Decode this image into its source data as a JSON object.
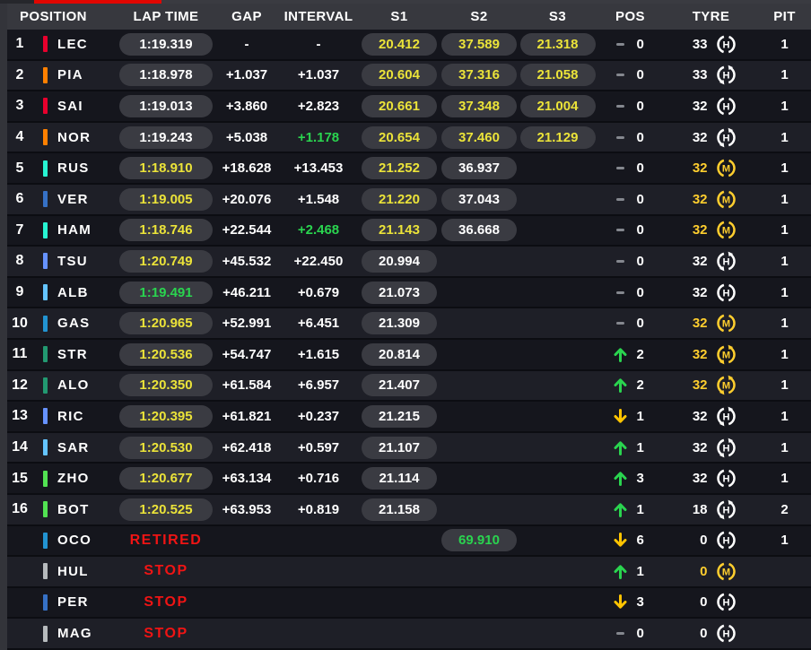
{
  "header": {
    "cols": [
      "POSITION",
      "LAP TIME",
      "GAP",
      "INTERVAL",
      "S1",
      "S2",
      "S3",
      "POS",
      "TYRE",
      "PIT"
    ]
  },
  "colors": {
    "accent_red": "#e10600",
    "sector_yellow": "#ebe339",
    "green": "#2ad44f",
    "tyre_medium_yellow": "#ffce2e",
    "tyre_hard_white": "#ffffff",
    "status_red": "#f01414"
  },
  "rows": [
    {
      "position": "1",
      "team_color": "#E8002D",
      "driver": "LEC",
      "lap_time": "1:19.319",
      "lap_color": "white",
      "lap_pill": true,
      "gap": "-",
      "interval": "-",
      "interval_color": "white",
      "s1": "20.412",
      "s1_color": "yellow",
      "s2": "37.589",
      "s2_color": "yellow",
      "s3": "21.318",
      "s3_color": "yellow",
      "pos_change_dir": "none",
      "pos_change": "0",
      "laps": "33",
      "laps_color": "white",
      "compound": "H",
      "compound_color": "#ffffff",
      "tyre_used": false,
      "pit": "1"
    },
    {
      "position": "2",
      "team_color": "#FF8000",
      "driver": "PIA",
      "lap_time": "1:18.978",
      "lap_color": "white",
      "lap_pill": true,
      "gap": "+1.037",
      "interval": "+1.037",
      "interval_color": "white",
      "s1": "20.604",
      "s1_color": "yellow",
      "s2": "37.316",
      "s2_color": "yellow",
      "s3": "21.058",
      "s3_color": "yellow",
      "pos_change_dir": "none",
      "pos_change": "0",
      "laps": "33",
      "laps_color": "white",
      "compound": "H",
      "compound_color": "#ffffff",
      "tyre_used": true,
      "pit": "1"
    },
    {
      "position": "3",
      "team_color": "#E8002D",
      "driver": "SAI",
      "lap_time": "1:19.013",
      "lap_color": "white",
      "lap_pill": true,
      "gap": "+3.860",
      "interval": "+2.823",
      "interval_color": "white",
      "s1": "20.661",
      "s1_color": "yellow",
      "s2": "37.348",
      "s2_color": "yellow",
      "s3": "21.004",
      "s3_color": "yellow",
      "pos_change_dir": "none",
      "pos_change": "0",
      "laps": "32",
      "laps_color": "white",
      "compound": "H",
      "compound_color": "#ffffff",
      "tyre_used": false,
      "pit": "1"
    },
    {
      "position": "4",
      "team_color": "#FF8000",
      "driver": "NOR",
      "lap_time": "1:19.243",
      "lap_color": "white",
      "lap_pill": true,
      "gap": "+5.038",
      "interval": "+1.178",
      "interval_color": "green",
      "s1": "20.654",
      "s1_color": "yellow",
      "s2": "37.460",
      "s2_color": "yellow",
      "s3": "21.129",
      "s3_color": "yellow",
      "pos_change_dir": "none",
      "pos_change": "0",
      "laps": "32",
      "laps_color": "white",
      "compound": "H",
      "compound_color": "#ffffff",
      "tyre_used": true,
      "pit": "1"
    },
    {
      "position": "5",
      "team_color": "#27F4D2",
      "driver": "RUS",
      "lap_time": "1:18.910",
      "lap_color": "yellow",
      "lap_pill": true,
      "gap": "+18.628",
      "interval": "+13.453",
      "interval_color": "white",
      "s1": "21.252",
      "s1_color": "yellow",
      "s2": "36.937",
      "s2_color": "white",
      "s3": "",
      "s3_color": "white",
      "pos_change_dir": "none",
      "pos_change": "0",
      "laps": "32",
      "laps_color": "tyellow",
      "compound": "M",
      "compound_color": "#ffce2e",
      "tyre_used": false,
      "pit": "1"
    },
    {
      "position": "6",
      "team_color": "#3671C6",
      "driver": "VER",
      "lap_time": "1:19.005",
      "lap_color": "yellow",
      "lap_pill": true,
      "gap": "+20.076",
      "interval": "+1.548",
      "interval_color": "white",
      "s1": "21.220",
      "s1_color": "yellow",
      "s2": "37.043",
      "s2_color": "white",
      "s3": "",
      "s3_color": "white",
      "pos_change_dir": "none",
      "pos_change": "0",
      "laps": "32",
      "laps_color": "tyellow",
      "compound": "M",
      "compound_color": "#ffce2e",
      "tyre_used": false,
      "pit": "1"
    },
    {
      "position": "7",
      "team_color": "#27F4D2",
      "driver": "HAM",
      "lap_time": "1:18.746",
      "lap_color": "yellow",
      "lap_pill": true,
      "gap": "+22.544",
      "interval": "+2.468",
      "interval_color": "green",
      "s1": "21.143",
      "s1_color": "yellow",
      "s2": "36.668",
      "s2_color": "white",
      "s3": "",
      "s3_color": "white",
      "pos_change_dir": "none",
      "pos_change": "0",
      "laps": "32",
      "laps_color": "tyellow",
      "compound": "M",
      "compound_color": "#ffce2e",
      "tyre_used": false,
      "pit": "1"
    },
    {
      "position": "8",
      "team_color": "#6692FF",
      "driver": "TSU",
      "lap_time": "1:20.749",
      "lap_color": "yellow",
      "lap_pill": true,
      "gap": "+45.532",
      "interval": "+22.450",
      "interval_color": "white",
      "s1": "20.994",
      "s1_color": "white",
      "s2": "",
      "s2_color": "white",
      "s3": "",
      "s3_color": "white",
      "pos_change_dir": "none",
      "pos_change": "0",
      "laps": "32",
      "laps_color": "white",
      "compound": "H",
      "compound_color": "#ffffff",
      "tyre_used": true,
      "pit": "1"
    },
    {
      "position": "9",
      "team_color": "#64C4FF",
      "driver": "ALB",
      "lap_time": "1:19.491",
      "lap_color": "green",
      "lap_pill": true,
      "gap": "+46.211",
      "interval": "+0.679",
      "interval_color": "white",
      "s1": "21.073",
      "s1_color": "white",
      "s2": "",
      "s2_color": "white",
      "s3": "",
      "s3_color": "white",
      "pos_change_dir": "none",
      "pos_change": "0",
      "laps": "32",
      "laps_color": "white",
      "compound": "H",
      "compound_color": "#ffffff",
      "tyre_used": false,
      "pit": "1"
    },
    {
      "position": "10",
      "team_color": "#2293D1",
      "driver": "GAS",
      "lap_time": "1:20.965",
      "lap_color": "yellow",
      "lap_pill": true,
      "gap": "+52.991",
      "interval": "+6.451",
      "interval_color": "white",
      "s1": "21.309",
      "s1_color": "white",
      "s2": "",
      "s2_color": "white",
      "s3": "",
      "s3_color": "white",
      "pos_change_dir": "none",
      "pos_change": "0",
      "laps": "32",
      "laps_color": "tyellow",
      "compound": "M",
      "compound_color": "#ffce2e",
      "tyre_used": false,
      "pit": "1"
    },
    {
      "position": "11",
      "team_color": "#229971",
      "driver": "STR",
      "lap_time": "1:20.536",
      "lap_color": "yellow",
      "lap_pill": true,
      "gap": "+54.747",
      "interval": "+1.615",
      "interval_color": "white",
      "s1": "20.814",
      "s1_color": "white",
      "s2": "",
      "s2_color": "white",
      "s3": "",
      "s3_color": "white",
      "pos_change_dir": "up",
      "pos_change": "2",
      "laps": "32",
      "laps_color": "tyellow",
      "compound": "M",
      "compound_color": "#ffce2e",
      "tyre_used": true,
      "pit": "1"
    },
    {
      "position": "12",
      "team_color": "#229971",
      "driver": "ALO",
      "lap_time": "1:20.350",
      "lap_color": "yellow",
      "lap_pill": true,
      "gap": "+61.584",
      "interval": "+6.957",
      "interval_color": "white",
      "s1": "21.407",
      "s1_color": "white",
      "s2": "",
      "s2_color": "white",
      "s3": "",
      "s3_color": "white",
      "pos_change_dir": "up",
      "pos_change": "2",
      "laps": "32",
      "laps_color": "tyellow",
      "compound": "M",
      "compound_color": "#ffce2e",
      "tyre_used": true,
      "pit": "1"
    },
    {
      "position": "13",
      "team_color": "#6692FF",
      "driver": "RIC",
      "lap_time": "1:20.395",
      "lap_color": "yellow",
      "lap_pill": true,
      "gap": "+61.821",
      "interval": "+0.237",
      "interval_color": "white",
      "s1": "21.215",
      "s1_color": "white",
      "s2": "",
      "s2_color": "white",
      "s3": "",
      "s3_color": "white",
      "pos_change_dir": "down",
      "pos_change": "1",
      "laps": "32",
      "laps_color": "white",
      "compound": "H",
      "compound_color": "#ffffff",
      "tyre_used": true,
      "pit": "1"
    },
    {
      "position": "14",
      "team_color": "#64C4FF",
      "driver": "SAR",
      "lap_time": "1:20.530",
      "lap_color": "yellow",
      "lap_pill": true,
      "gap": "+62.418",
      "interval": "+0.597",
      "interval_color": "white",
      "s1": "21.107",
      "s1_color": "white",
      "s2": "",
      "s2_color": "white",
      "s3": "",
      "s3_color": "white",
      "pos_change_dir": "up",
      "pos_change": "1",
      "laps": "32",
      "laps_color": "white",
      "compound": "H",
      "compound_color": "#ffffff",
      "tyre_used": true,
      "pit": "1"
    },
    {
      "position": "15",
      "team_color": "#52E252",
      "driver": "ZHO",
      "lap_time": "1:20.677",
      "lap_color": "yellow",
      "lap_pill": true,
      "gap": "+63.134",
      "interval": "+0.716",
      "interval_color": "white",
      "s1": "21.114",
      "s1_color": "white",
      "s2": "",
      "s2_color": "white",
      "s3": "",
      "s3_color": "white",
      "pos_change_dir": "up",
      "pos_change": "3",
      "laps": "32",
      "laps_color": "white",
      "compound": "H",
      "compound_color": "#ffffff",
      "tyre_used": false,
      "pit": "1"
    },
    {
      "position": "16",
      "team_color": "#52E252",
      "driver": "BOT",
      "lap_time": "1:20.525",
      "lap_color": "yellow",
      "lap_pill": true,
      "gap": "+63.953",
      "interval": "+0.819",
      "interval_color": "white",
      "s1": "21.158",
      "s1_color": "white",
      "s2": "",
      "s2_color": "white",
      "s3": "",
      "s3_color": "white",
      "pos_change_dir": "up",
      "pos_change": "1",
      "laps": "18",
      "laps_color": "white",
      "compound": "H",
      "compound_color": "#ffffff",
      "tyre_used": true,
      "pit": "2"
    },
    {
      "position": "",
      "team_color": "#2293D1",
      "driver": "OCO",
      "lap_time": "RETIRED",
      "lap_color": "red",
      "lap_pill": false,
      "gap": "",
      "interval": "",
      "interval_color": "white",
      "s1": "",
      "s1_color": "white",
      "s2": "69.910",
      "s2_color": "green",
      "s3": "",
      "s3_color": "white",
      "pos_change_dir": "down",
      "pos_change": "6",
      "laps": "0",
      "laps_color": "white",
      "compound": "H",
      "compound_color": "#ffffff",
      "tyre_used": false,
      "pit": "1"
    },
    {
      "position": "",
      "team_color": "#B6BABD",
      "driver": "HUL",
      "lap_time": "STOP",
      "lap_color": "red",
      "lap_pill": false,
      "gap": "",
      "interval": "",
      "interval_color": "white",
      "s1": "",
      "s1_color": "white",
      "s2": "",
      "s2_color": "white",
      "s3": "",
      "s3_color": "white",
      "pos_change_dir": "up",
      "pos_change": "1",
      "laps": "0",
      "laps_color": "tyellow",
      "compound": "M",
      "compound_color": "#ffce2e",
      "tyre_used": false,
      "pit": ""
    },
    {
      "position": "",
      "team_color": "#3671C6",
      "driver": "PER",
      "lap_time": "STOP",
      "lap_color": "red",
      "lap_pill": false,
      "gap": "",
      "interval": "",
      "interval_color": "white",
      "s1": "",
      "s1_color": "white",
      "s2": "",
      "s2_color": "white",
      "s3": "",
      "s3_color": "white",
      "pos_change_dir": "down",
      "pos_change": "3",
      "laps": "0",
      "laps_color": "white",
      "compound": "H",
      "compound_color": "#ffffff",
      "tyre_used": false,
      "pit": ""
    },
    {
      "position": "",
      "team_color": "#B6BABD",
      "driver": "MAG",
      "lap_time": "STOP",
      "lap_color": "red",
      "lap_pill": false,
      "gap": "",
      "interval": "",
      "interval_color": "white",
      "s1": "",
      "s1_color": "white",
      "s2": "",
      "s2_color": "white",
      "s3": "",
      "s3_color": "white",
      "pos_change_dir": "none",
      "pos_change": "0",
      "laps": "0",
      "laps_color": "white",
      "compound": "H",
      "compound_color": "#ffffff",
      "tyre_used": false,
      "pit": ""
    }
  ]
}
